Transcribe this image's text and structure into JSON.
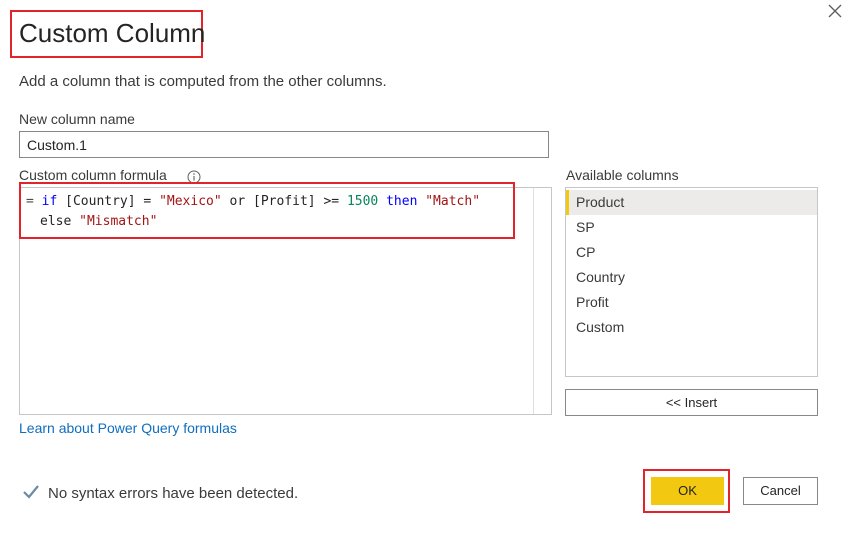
{
  "dialog": {
    "title": "Custom Column",
    "subtitle": "Add a column that is computed from the other columns."
  },
  "name_field": {
    "label": "New column name",
    "value": "Custom.1"
  },
  "formula": {
    "label": "Custom column formula",
    "line1": {
      "eq": "=",
      "kw_if": "if",
      "col1": "[Country]",
      "op1": "=",
      "str1": "\"Mexico\"",
      "kw_or": "or",
      "col2": "[Profit]",
      "op2": ">=",
      "num": "1500",
      "kw_then": "then",
      "str2": "\"Match\""
    },
    "line2": {
      "kw_else": "else",
      "str3": "\"Mismatch\""
    }
  },
  "available_columns": {
    "label": "Available columns",
    "items": [
      "Product",
      "SP",
      "CP",
      "Country",
      "Profit",
      "Custom"
    ],
    "selected": "Product"
  },
  "buttons": {
    "insert": "<< Insert",
    "ok": "OK",
    "cancel": "Cancel"
  },
  "learn_link": "Learn about Power Query formulas",
  "status_text": "No syntax errors have been detected.",
  "colors": {
    "accent": "#f2c811",
    "highlight": "#e2232b",
    "link": "#106ebe"
  }
}
